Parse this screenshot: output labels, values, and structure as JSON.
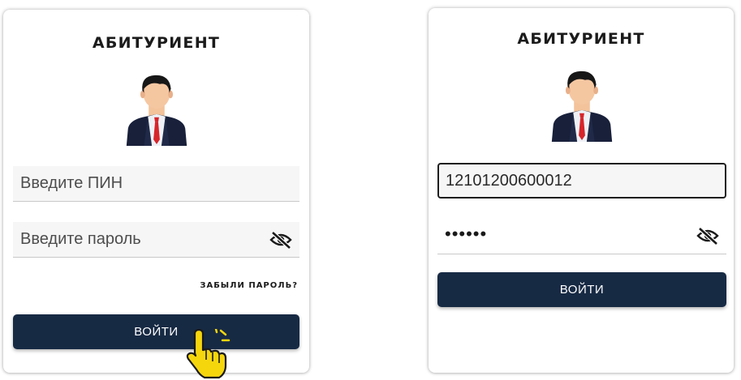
{
  "left_card": {
    "title": "АБИТУРИЕНТ",
    "pin": {
      "placeholder": "Введите ПИН",
      "value": ""
    },
    "password": {
      "placeholder": "Введите пароль",
      "value": ""
    },
    "forgot_link": "ЗАБЫЛИ ПАРОЛЬ?",
    "login_button": "ВОЙТИ"
  },
  "right_card": {
    "title": "АБИТУРИЕНТ",
    "pin": {
      "value": "12101200600012"
    },
    "password": {
      "masked_value": "••••••"
    },
    "login_button": "ВОЙТИ"
  },
  "icons": {
    "avatar": "user-avatar-icon",
    "eye_toggle": "eye-slash-icon",
    "cursor": "hand-pointer-icon"
  },
  "colors": {
    "button_bg": "#172a44",
    "cursor_yellow": "#f5d60d"
  }
}
